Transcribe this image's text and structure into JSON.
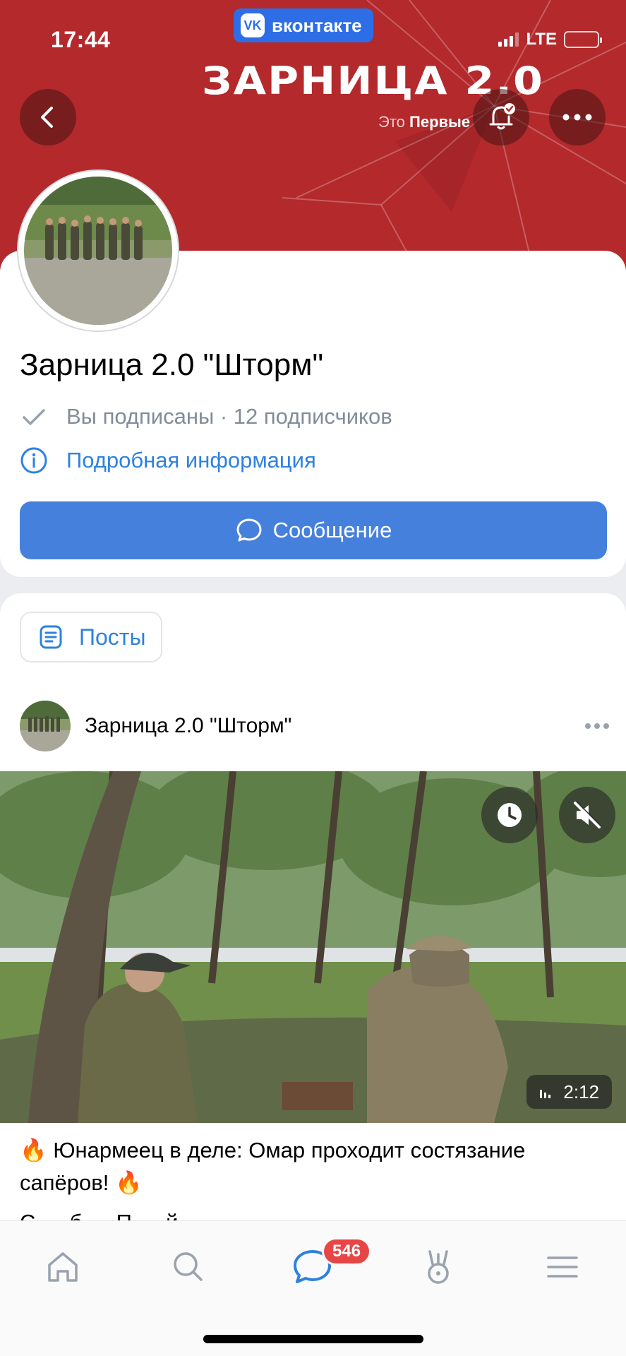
{
  "status_bar": {
    "time": "17:44",
    "network": "LTE"
  },
  "app_badge": {
    "logo": "VK",
    "label": "вконтакте"
  },
  "cover": {
    "title": "ЗАРНИЦА 2.0",
    "subtitle_prefix": "Это",
    "subtitle_bold": "Первые",
    "background_color": "#b3292c"
  },
  "header_buttons": {
    "back": "back-icon",
    "notifications": "bell-check-icon",
    "more": "more-horizontal-icon"
  },
  "profile": {
    "name": "Зарница 2.0 \"Шторм\"",
    "subscription_status": "Вы подписаны · 12 подписчиков",
    "details_link": "Подробная информация",
    "message_button": "Сообщение"
  },
  "feed": {
    "filter_chip": "Посты",
    "post": {
      "author": "Зарница 2.0 \"Шторм\"",
      "video_duration": "2:12",
      "text_line1": "🔥 Юнармеец в деле: Омар проходит состязание",
      "text_line2": "сапёров! 🔥",
      "text_cut": "С … б … П … й"
    }
  },
  "tabbar": {
    "items": [
      "home-icon",
      "search-icon",
      "messages-icon",
      "clips-icon",
      "menu-icon"
    ],
    "messages_badge": "546"
  },
  "colors": {
    "accent": "#4680dd",
    "link": "#2d81e0",
    "badge": "#e64646",
    "secondary_text": "#818c99"
  }
}
